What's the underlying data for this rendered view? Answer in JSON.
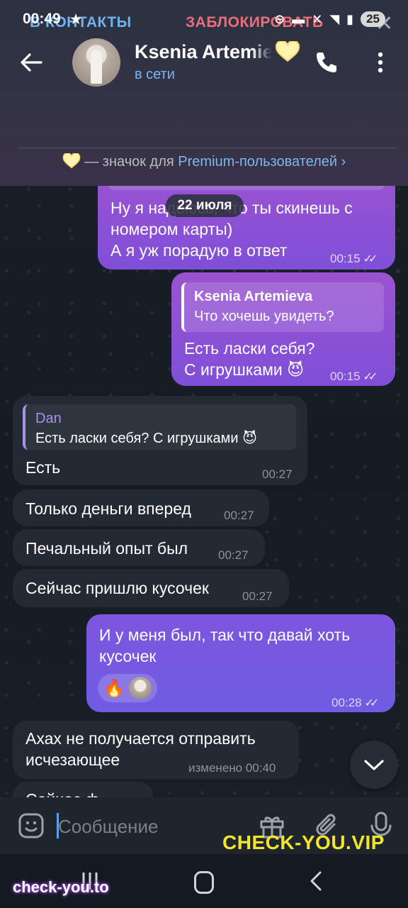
{
  "status_bar": {
    "time": "00:49",
    "battery": "25"
  },
  "header": {
    "contact_name": "Ksenia Artemieva",
    "status": "в сети",
    "add_contact_label": "В КОНТАКТЫ",
    "block_label": "ЗАБЛОКИРОВАТЬ",
    "premium_prefix": "— значок для ",
    "premium_link": "Premium-пользователей ›"
  },
  "date_chip": "22 июля",
  "messages": [
    {
      "id": "m1",
      "dir": "out",
      "lines": [
        "Ну я надеюсь, что ты скинешь с",
        "номером карты)",
        "А я уж порадую в ответ"
      ],
      "time": "00:15",
      "read": "✓✓"
    },
    {
      "id": "m2",
      "dir": "out",
      "reply_author": "Ksenia Artemieva",
      "reply_text": "Что хочешь увидеть?",
      "lines": [
        "Есть ласки себя?",
        "С игрушками 😈"
      ],
      "time": "00:15",
      "read": "✓✓"
    },
    {
      "id": "m3",
      "dir": "in",
      "reply_author": "Dan",
      "reply_text": "Есть ласки себя? С игрушками 😈",
      "lines": [
        "Есть"
      ],
      "time": "00:27"
    },
    {
      "id": "m4",
      "dir": "in",
      "lines": [
        "Только деньги вперед"
      ],
      "time": "00:27"
    },
    {
      "id": "m5",
      "dir": "in",
      "lines": [
        "Печальный опыт был"
      ],
      "time": "00:27"
    },
    {
      "id": "m6",
      "dir": "in",
      "lines": [
        "Сейчас пришлю кусочек"
      ],
      "time": "00:27"
    },
    {
      "id": "m7",
      "dir": "out",
      "lines": [
        "И у меня был, так что давай хоть",
        "кусочек"
      ],
      "reaction": "🔥",
      "time": "00:28",
      "read": "✓✓"
    },
    {
      "id": "m8",
      "dir": "in",
      "lines": [
        "Ахах не получается отправить",
        "исчезающее"
      ],
      "time": "изменено 00:40"
    },
    {
      "id": "m9",
      "dir": "in",
      "lines": [
        "Сейчас ф"
      ]
    }
  ],
  "input": {
    "placeholder": "Сообщение"
  },
  "watermarks": {
    "right": "CHECK-YOU.VIP",
    "left": "check-you.to"
  },
  "colors": {
    "accent_blue": "#6fb3f0",
    "block_red": "#ee6d78",
    "out_bubble": "#8e52d4",
    "in_bubble": "#232a33",
    "watermark_yellow": "#f3e42c"
  },
  "icons": [
    "back-arrow-icon",
    "phone-icon",
    "more-vert-icon",
    "close-icon",
    "premium-heart-icon",
    "double-check-icon",
    "chevron-down-icon",
    "emoji-icon",
    "gift-icon",
    "attach-icon",
    "mic-icon"
  ]
}
